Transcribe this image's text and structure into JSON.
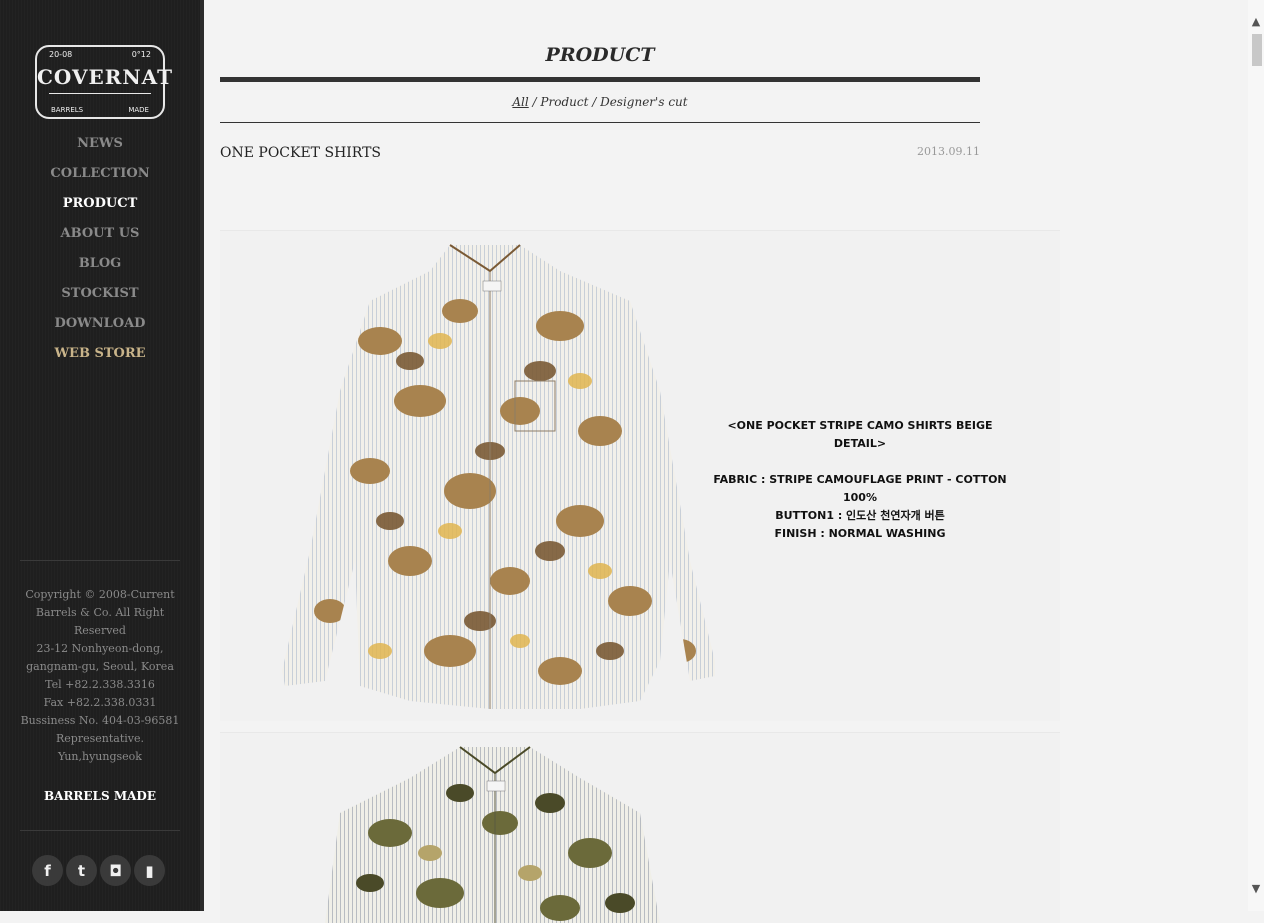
{
  "logo": {
    "year_left": "20-08",
    "year_right": "0°12",
    "brand": "COVERNAT",
    "sub_left": "BARRELS",
    "sub_right": "MADE"
  },
  "nav": {
    "items": [
      "NEWS",
      "COLLECTION",
      "PRODUCT",
      "ABOUT US",
      "BLOG",
      "STOCKIST",
      "DOWNLOAD",
      "WEB STORE"
    ],
    "active": "PRODUCT"
  },
  "footer": {
    "copyright": [
      "Copyright © 2008-Current",
      "Barrels & Co. All Right",
      "Reserved",
      "23-12 Nonhyeon-dong,",
      "gangnam-gu, Seoul, Korea",
      "Tel +82.2.338.3316",
      "Fax +82.2.338.0331",
      "Bussiness No. 404-03-96581",
      "Representative.",
      "Yun,hyungseok"
    ],
    "tagline": "BARRELS MADE"
  },
  "social": [
    {
      "name": "facebook-icon",
      "glyph": "f"
    },
    {
      "name": "twitter-icon",
      "glyph": "t"
    },
    {
      "name": "instagram-icon",
      "glyph": "◘"
    },
    {
      "name": "bookmark-icon",
      "glyph": "▮"
    }
  ],
  "page": {
    "title": "PRODUCT",
    "breadcrumb": {
      "all": "All",
      "sep": " / ",
      "product": "Product",
      "cut": "Designer's cut"
    }
  },
  "post": {
    "title": "ONE POCKET SHIRTS",
    "date": "2013.09.11",
    "detail": {
      "head": "<ONE POCKET STRIPE CAMO SHIRTS BEIGE DETAIL>",
      "lines": [
        "FABRIC :  STRIPE CAMOUFLAGE PRINT - COTTON 100%",
        "BUTTON1 : 인도산 천연자개 버튼",
        "FINISH : NORMAL WASHING"
      ]
    }
  },
  "colors": {
    "sidebar_bg": "#1f1f1f",
    "nav_inactive": "#8a8a8a",
    "nav_active": "#ffffff",
    "webstore": "#c9b48a",
    "camo1": [
      "#f2f0ea",
      "#d9c28a",
      "#a8834f",
      "#7a5a35",
      "#e0b550"
    ],
    "camo2": [
      "#f0efe8",
      "#6b6a3a",
      "#8a7440",
      "#4a4a28",
      "#b5a46a"
    ]
  }
}
